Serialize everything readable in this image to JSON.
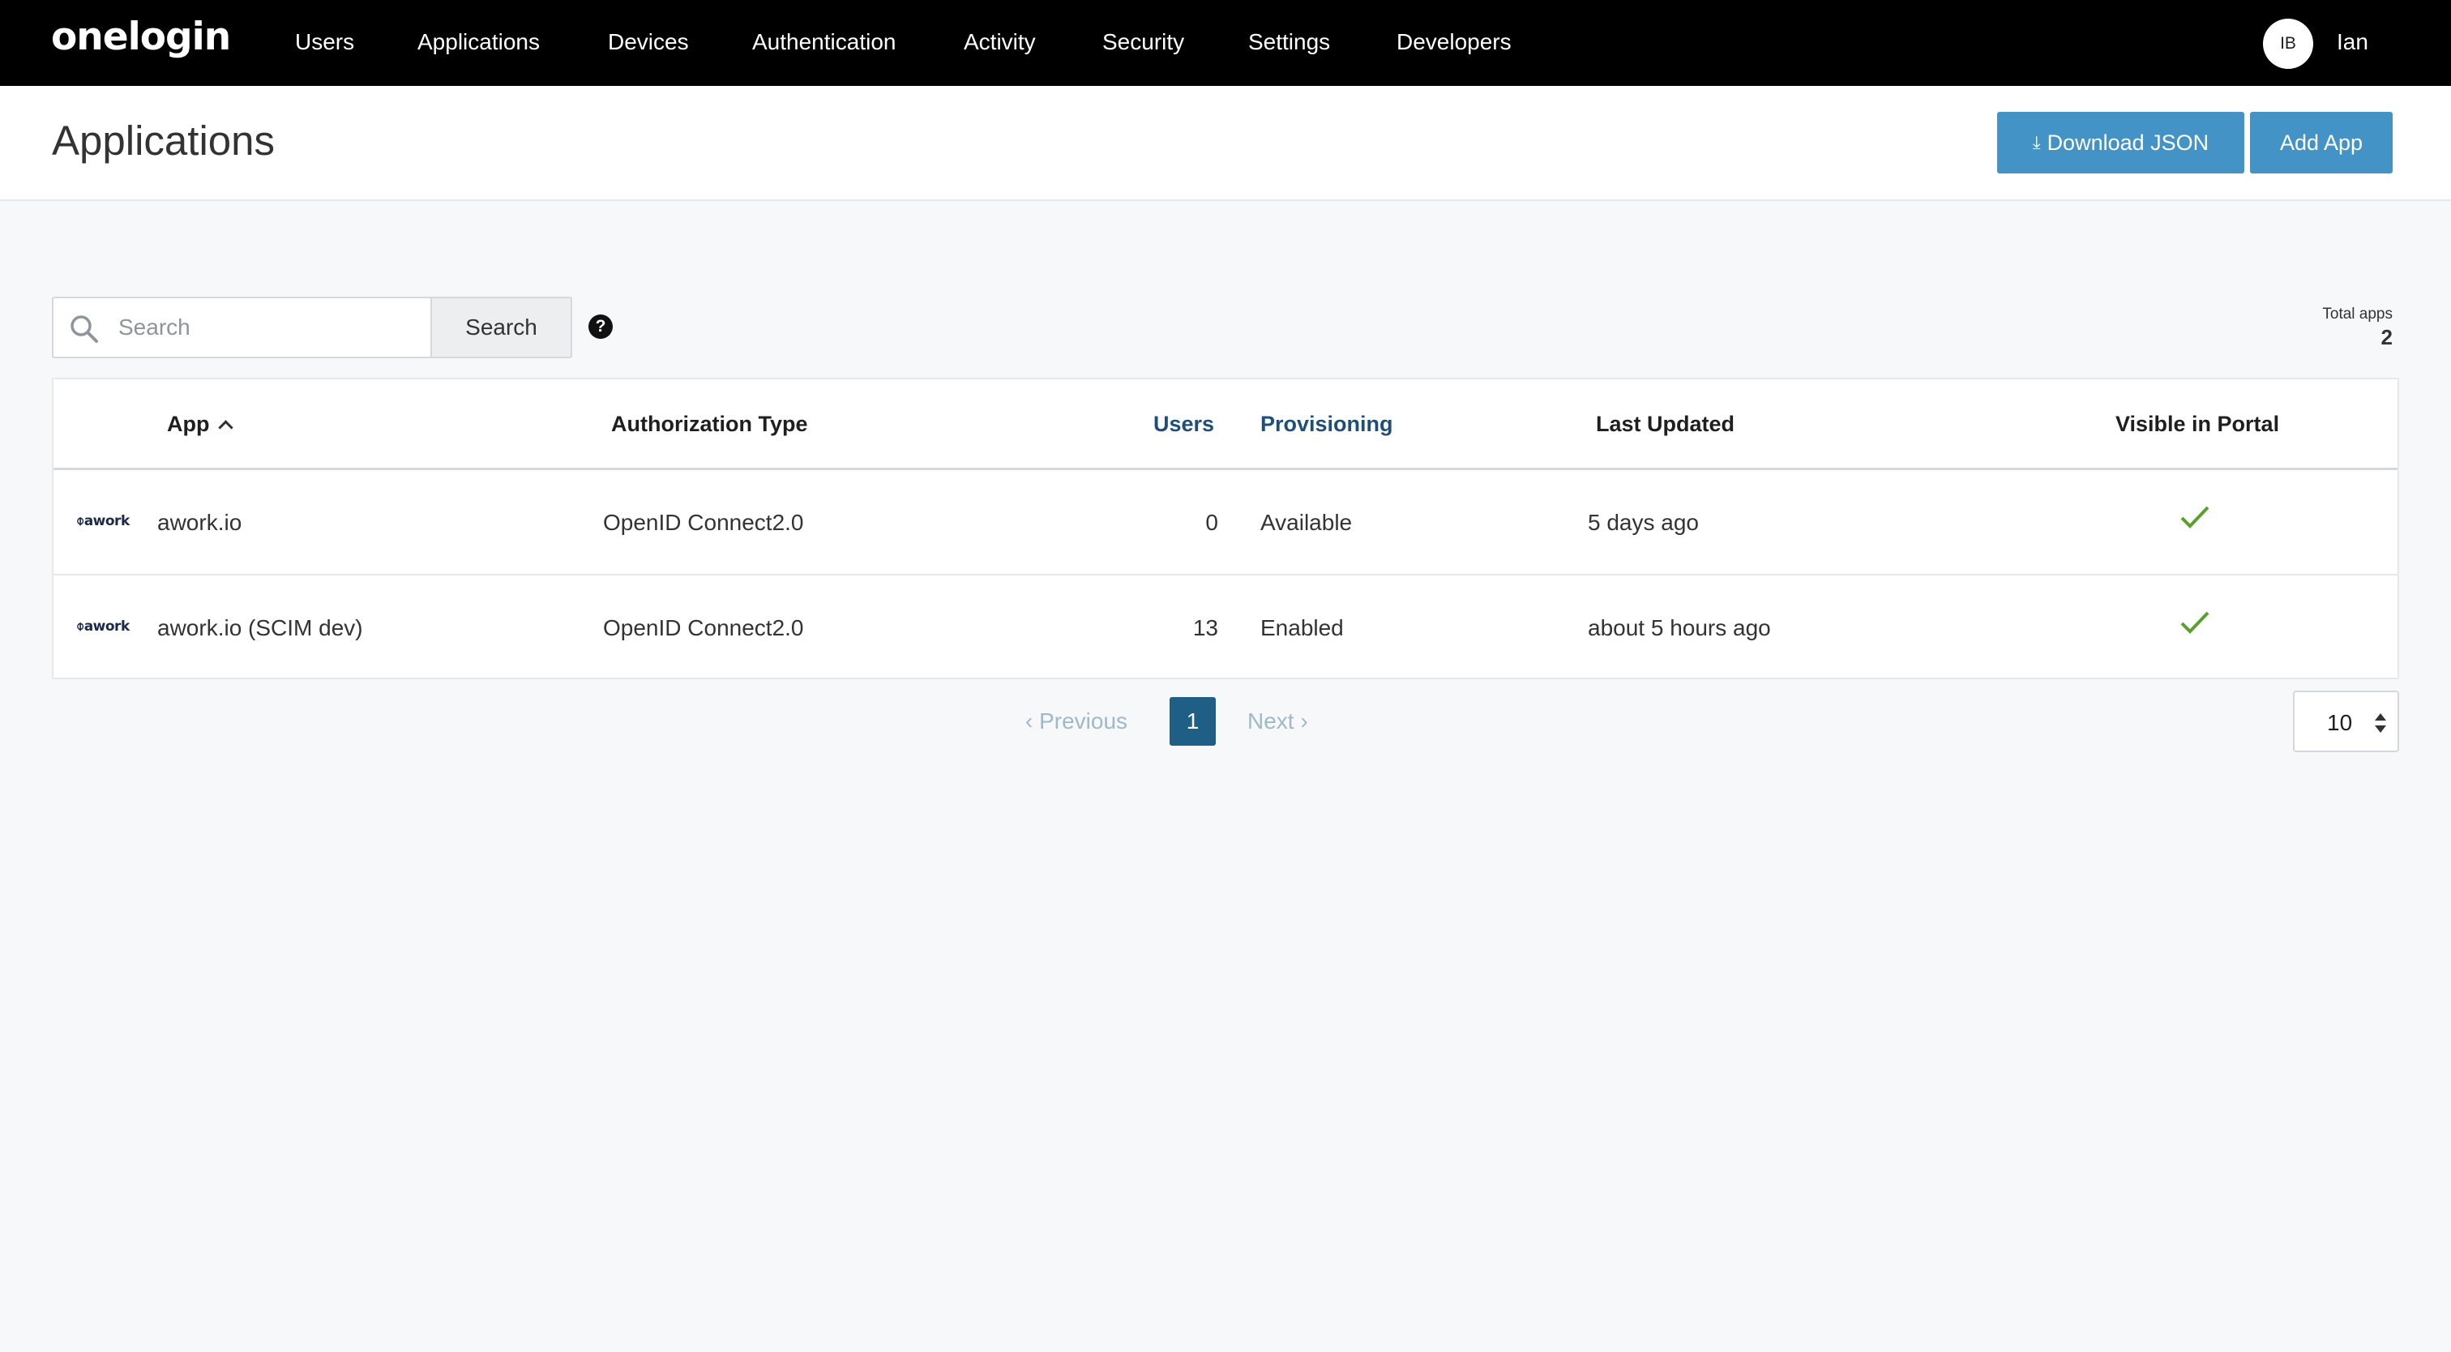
{
  "nav": {
    "logo": "onelogin",
    "items": [
      {
        "label": "Users"
      },
      {
        "label": "Applications"
      },
      {
        "label": "Devices"
      },
      {
        "label": "Authentication"
      },
      {
        "label": "Activity"
      },
      {
        "label": "Security"
      },
      {
        "label": "Settings"
      },
      {
        "label": "Developers"
      }
    ],
    "user_initials": "IB",
    "user_name": "Ian"
  },
  "header": {
    "title": "Applications",
    "download_label": "Download JSON",
    "add_label": "Add App",
    "accent_color": "#4393c6"
  },
  "search": {
    "placeholder": "Search",
    "value": "",
    "button_label": "Search",
    "total_label": "Total apps",
    "total_value": "2"
  },
  "table": {
    "columns": [
      {
        "label": "App"
      },
      {
        "label": "Authorization Type"
      },
      {
        "label": "Users"
      },
      {
        "label": "Provisioning"
      },
      {
        "label": "Last Updated"
      },
      {
        "label": "Visible in Portal"
      }
    ],
    "rows": [
      {
        "logo": "awork",
        "app": "awork.io",
        "auth_type": "OpenID Connect2.0",
        "users": "0",
        "provisioning": "Available",
        "last_updated": "5 days ago",
        "visible_icon": "check-icon"
      },
      {
        "logo": "awork",
        "app": "awork.io (SCIM dev)",
        "auth_type": "OpenID Connect2.0",
        "users": "13",
        "provisioning": "Enabled",
        "last_updated": "about 5 hours ago",
        "visible_icon": "check-icon"
      }
    ]
  },
  "pagination": {
    "previous_label": "Previous",
    "current_page": "1",
    "next_label": "Next",
    "page_size": "10"
  }
}
